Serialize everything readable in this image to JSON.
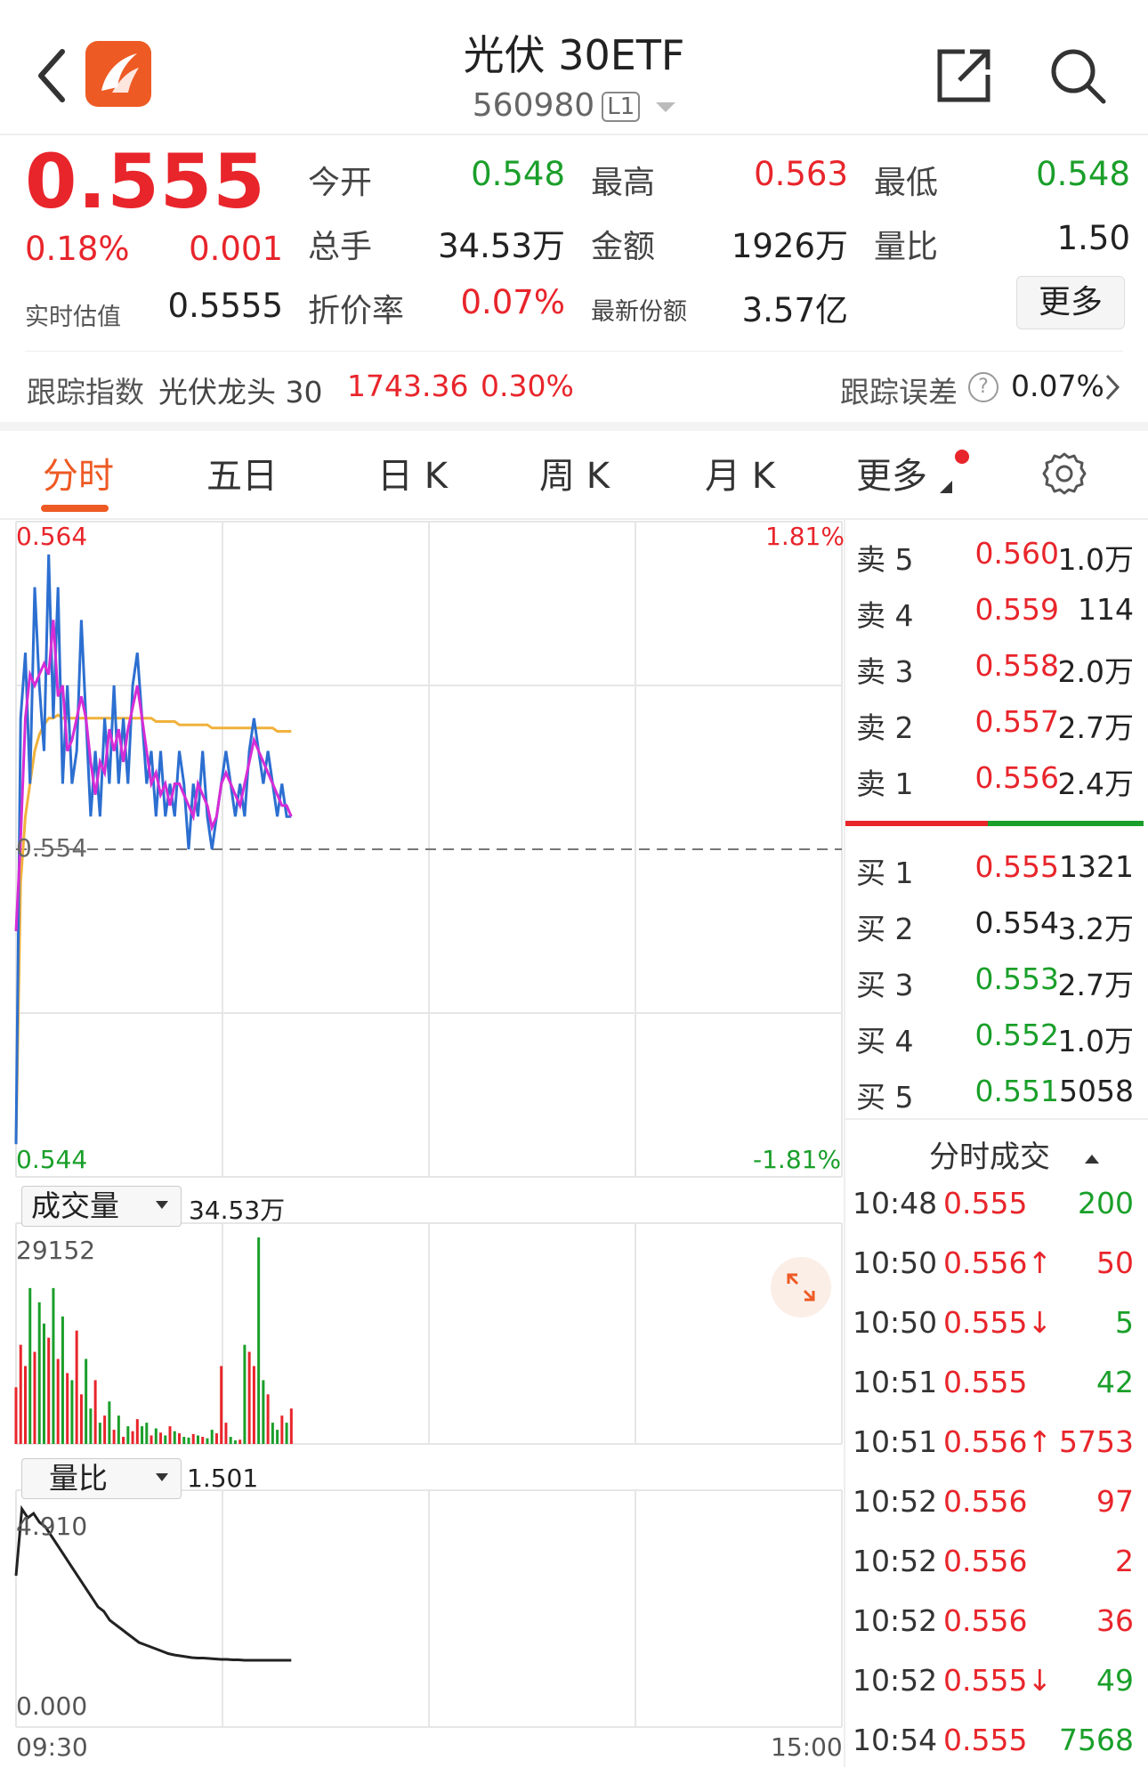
{
  "header": {
    "title": "光伏 30ETF",
    "code": "560980",
    "level": "L1"
  },
  "quote": {
    "last_price": "0.555",
    "change_pct": "0.18%",
    "change": "0.001",
    "estimate_label": "实时估值",
    "estimate_value": "0.5555",
    "fields": [
      {
        "label": "今开",
        "value": "0.548",
        "color": "green"
      },
      {
        "label": "最高",
        "value": "0.563",
        "color": "red"
      },
      {
        "label": "最低",
        "value": "0.548",
        "color": "green"
      },
      {
        "label": "总手",
        "value": "34.53万",
        "color": "dark"
      },
      {
        "label": "金额",
        "value": "1926万",
        "color": "dark"
      },
      {
        "label": "量比",
        "value": "1.50",
        "color": "dark"
      },
      {
        "label": "折价率",
        "value": "0.07%",
        "color": "red"
      },
      {
        "label": "最新份额",
        "value": "3.57亿",
        "color": "dark"
      }
    ],
    "more_label": "更多"
  },
  "tracking": {
    "label": "跟踪指数",
    "index_name": "光伏龙头 30",
    "index_value": "1743.36",
    "index_change": "0.30%",
    "error_label": "跟踪误差",
    "error_value": "0.07%"
  },
  "tabs": [
    {
      "label": "分时",
      "active": true
    },
    {
      "label": "五日"
    },
    {
      "label": "日 K"
    },
    {
      "label": "周 K"
    },
    {
      "label": "月 K"
    },
    {
      "label": "更多"
    }
  ],
  "intraday": {
    "price_high": "0.564",
    "price_low": "0.544",
    "price_mid": "0.554",
    "pct_high": "1.81%",
    "pct_low": "-1.81%",
    "volume_label": "成交量",
    "volume_total": "34.53万",
    "volume_max": "29152",
    "ratio_label": "量比",
    "ratio_value": "1.501",
    "ratio_max": "4.910",
    "ratio_min": "0.000",
    "time_start": "09:30",
    "time_end": "15:00"
  },
  "chart_data": {
    "type": "line",
    "price_range": [
      0.544,
      0.564
    ],
    "prev_close": 0.554,
    "price": [
      0.545,
      0.558,
      0.56,
      0.556,
      0.562,
      0.559,
      0.557,
      0.563,
      0.558,
      0.562,
      0.556,
      0.559,
      0.556,
      0.557,
      0.561,
      0.558,
      0.555,
      0.557,
      0.555,
      0.558,
      0.556,
      0.559,
      0.556,
      0.558,
      0.556,
      0.559,
      0.56,
      0.558,
      0.556,
      0.557,
      0.555,
      0.557,
      0.555,
      0.556,
      0.555,
      0.557,
      0.556,
      0.554,
      0.556,
      0.555,
      0.557,
      0.555,
      0.554,
      0.555,
      0.556,
      0.557,
      0.556,
      0.555,
      0.556,
      0.555,
      0.557,
      0.558,
      0.557,
      0.556,
      0.557,
      0.556,
      0.555,
      0.556,
      0.555,
      0.555
    ],
    "avg": [
      0.545,
      0.553,
      0.555,
      0.556,
      0.557,
      0.5575,
      0.5578,
      0.558,
      0.558,
      0.5581,
      0.558,
      0.558,
      0.558,
      0.558,
      0.558,
      0.558,
      0.558,
      0.558,
      0.558,
      0.558,
      0.558,
      0.558,
      0.558,
      0.558,
      0.558,
      0.558,
      0.558,
      0.558,
      0.558,
      0.558,
      0.5579,
      0.5579,
      0.5579,
      0.5579,
      0.5579,
      0.5578,
      0.5578,
      0.5578,
      0.5578,
      0.5578,
      0.5578,
      0.5578,
      0.5577,
      0.5577,
      0.5577,
      0.5577,
      0.5577,
      0.5577,
      0.5577,
      0.5577,
      0.5577,
      0.5577,
      0.5577,
      0.5577,
      0.5577,
      0.5577,
      0.5576,
      0.5576,
      0.5576,
      0.5576
    ],
    "volume": [
      8000,
      14000,
      11000,
      22000,
      13000,
      20000,
      17000,
      15000,
      22000,
      12000,
      18000,
      10000,
      9000,
      16000,
      7000,
      12000,
      5000,
      9000,
      3000,
      4000,
      6000,
      2000,
      4000,
      1000,
      2500,
      1800,
      3500,
      2500,
      3000,
      1200,
      2200,
      1600,
      1200,
      2500,
      1800,
      1500,
      1000,
      900,
      1400,
      1200,
      1000,
      800,
      2000,
      1500,
      11000,
      3000,
      1000,
      500,
      600,
      14000,
      13000,
      11000,
      29152,
      9000,
      7000,
      3000,
      2000,
      4000,
      3000,
      5000
    ],
    "ratio": [
      3.4,
      4.9,
      4.7,
      4.8,
      4.6,
      4.5,
      4.3,
      4.1,
      3.9,
      3.7,
      3.5,
      3.3,
      3.1,
      2.9,
      2.7,
      2.6,
      2.4,
      2.3,
      2.2,
      2.1,
      2.0,
      1.9,
      1.85,
      1.8,
      1.75,
      1.7,
      1.65,
      1.62,
      1.6,
      1.58,
      1.56,
      1.55,
      1.55,
      1.54,
      1.53,
      1.52,
      1.52,
      1.51,
      1.51,
      1.5,
      1.5,
      1.5,
      1.5,
      1.5,
      1.5,
      1.5,
      1.5,
      1.501
    ]
  },
  "order_book": {
    "asks": [
      {
        "label": "卖 5",
        "price": "0.560",
        "vol": "1.0万",
        "color": "red"
      },
      {
        "label": "卖 4",
        "price": "0.559",
        "vol": "114",
        "color": "red"
      },
      {
        "label": "卖 3",
        "price": "0.558",
        "vol": "2.0万",
        "color": "red"
      },
      {
        "label": "卖 2",
        "price": "0.557",
        "vol": "2.7万",
        "color": "red"
      },
      {
        "label": "卖 1",
        "price": "0.556",
        "vol": "2.4万",
        "color": "red"
      }
    ],
    "bids": [
      {
        "label": "买 1",
        "price": "0.555",
        "vol": "1321",
        "color": "red"
      },
      {
        "label": "买 2",
        "price": "0.554",
        "vol": "3.2万",
        "color": "dark"
      },
      {
        "label": "买 3",
        "price": "0.553",
        "vol": "2.7万",
        "color": "green"
      },
      {
        "label": "买 4",
        "price": "0.552",
        "vol": "1.0万",
        "color": "green"
      },
      {
        "label": "买 5",
        "price": "0.551",
        "vol": "5058",
        "color": "green"
      }
    ]
  },
  "ticks_header": "分时成交",
  "ticks": [
    {
      "time": "10:48",
      "price": "0.555",
      "vol": "200",
      "vcolor": "green"
    },
    {
      "time": "10:50",
      "price": "0.556↑",
      "vol": "50",
      "vcolor": "red"
    },
    {
      "time": "10:50",
      "price": "0.555↓",
      "vol": "5",
      "vcolor": "green"
    },
    {
      "time": "10:51",
      "price": "0.555",
      "vol": "42",
      "vcolor": "green"
    },
    {
      "time": "10:51",
      "price": "0.556↑",
      "vol": "5753",
      "vcolor": "red"
    },
    {
      "time": "10:52",
      "price": "0.556",
      "vol": "97",
      "vcolor": "red"
    },
    {
      "time": "10:52",
      "price": "0.556",
      "vol": "2",
      "vcolor": "red"
    },
    {
      "time": "10:52",
      "price": "0.556",
      "vol": "36",
      "vcolor": "red"
    },
    {
      "time": "10:52",
      "price": "0.555↓",
      "vol": "49",
      "vcolor": "green"
    },
    {
      "time": "10:54",
      "price": "0.555",
      "vol": "7568",
      "vcolor": "green"
    }
  ],
  "colors": {
    "up": "#e8252b",
    "down": "#1a9f2a",
    "accent": "#ee5a24",
    "price_line": "#2c6fd1",
    "ma_line": "#d62cd6",
    "avg_line": "#f0b23c"
  }
}
